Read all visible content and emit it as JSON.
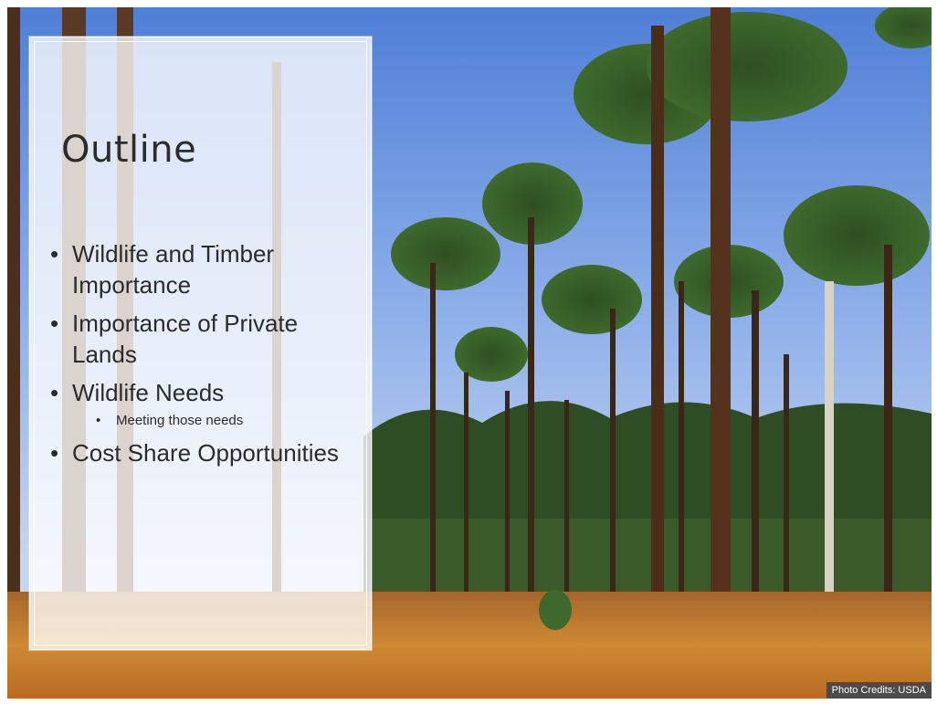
{
  "slide": {
    "title": "Outline",
    "bullets": [
      {
        "text": "Wildlife and Timber Importance"
      },
      {
        "text": "Importance of Private Lands"
      },
      {
        "text": "Wildlife Needs",
        "sub": [
          "Meeting those needs"
        ]
      },
      {
        "text": "Cost Share Opportunities"
      }
    ],
    "photo_credit": "Photo Credits: USDA"
  },
  "colors": {
    "sky": "#7ea1e0",
    "grass": "#c9802c",
    "panel": "#ffffff",
    "text": "#2b2b2b"
  }
}
